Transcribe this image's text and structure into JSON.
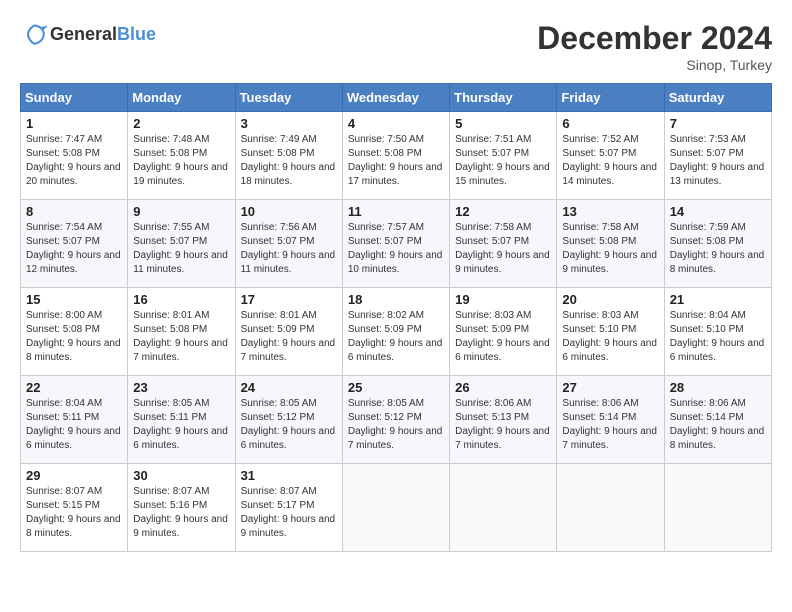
{
  "header": {
    "logo_general": "General",
    "logo_blue": "Blue",
    "month": "December 2024",
    "location": "Sinop, Turkey"
  },
  "weekdays": [
    "Sunday",
    "Monday",
    "Tuesday",
    "Wednesday",
    "Thursday",
    "Friday",
    "Saturday"
  ],
  "weeks": [
    [
      {
        "day": "1",
        "sunrise": "7:47 AM",
        "sunset": "5:08 PM",
        "daylight": "9 hours and 20 minutes."
      },
      {
        "day": "2",
        "sunrise": "7:48 AM",
        "sunset": "5:08 PM",
        "daylight": "9 hours and 19 minutes."
      },
      {
        "day": "3",
        "sunrise": "7:49 AM",
        "sunset": "5:08 PM",
        "daylight": "9 hours and 18 minutes."
      },
      {
        "day": "4",
        "sunrise": "7:50 AM",
        "sunset": "5:08 PM",
        "daylight": "9 hours and 17 minutes."
      },
      {
        "day": "5",
        "sunrise": "7:51 AM",
        "sunset": "5:07 PM",
        "daylight": "9 hours and 15 minutes."
      },
      {
        "day": "6",
        "sunrise": "7:52 AM",
        "sunset": "5:07 PM",
        "daylight": "9 hours and 14 minutes."
      },
      {
        "day": "7",
        "sunrise": "7:53 AM",
        "sunset": "5:07 PM",
        "daylight": "9 hours and 13 minutes."
      }
    ],
    [
      {
        "day": "8",
        "sunrise": "7:54 AM",
        "sunset": "5:07 PM",
        "daylight": "9 hours and 12 minutes."
      },
      {
        "day": "9",
        "sunrise": "7:55 AM",
        "sunset": "5:07 PM",
        "daylight": "9 hours and 11 minutes."
      },
      {
        "day": "10",
        "sunrise": "7:56 AM",
        "sunset": "5:07 PM",
        "daylight": "9 hours and 11 minutes."
      },
      {
        "day": "11",
        "sunrise": "7:57 AM",
        "sunset": "5:07 PM",
        "daylight": "9 hours and 10 minutes."
      },
      {
        "day": "12",
        "sunrise": "7:58 AM",
        "sunset": "5:07 PM",
        "daylight": "9 hours and 9 minutes."
      },
      {
        "day": "13",
        "sunrise": "7:58 AM",
        "sunset": "5:08 PM",
        "daylight": "9 hours and 9 minutes."
      },
      {
        "day": "14",
        "sunrise": "7:59 AM",
        "sunset": "5:08 PM",
        "daylight": "9 hours and 8 minutes."
      }
    ],
    [
      {
        "day": "15",
        "sunrise": "8:00 AM",
        "sunset": "5:08 PM",
        "daylight": "9 hours and 8 minutes."
      },
      {
        "day": "16",
        "sunrise": "8:01 AM",
        "sunset": "5:08 PM",
        "daylight": "9 hours and 7 minutes."
      },
      {
        "day": "17",
        "sunrise": "8:01 AM",
        "sunset": "5:09 PM",
        "daylight": "9 hours and 7 minutes."
      },
      {
        "day": "18",
        "sunrise": "8:02 AM",
        "sunset": "5:09 PM",
        "daylight": "9 hours and 6 minutes."
      },
      {
        "day": "19",
        "sunrise": "8:03 AM",
        "sunset": "5:09 PM",
        "daylight": "9 hours and 6 minutes."
      },
      {
        "day": "20",
        "sunrise": "8:03 AM",
        "sunset": "5:10 PM",
        "daylight": "9 hours and 6 minutes."
      },
      {
        "day": "21",
        "sunrise": "8:04 AM",
        "sunset": "5:10 PM",
        "daylight": "9 hours and 6 minutes."
      }
    ],
    [
      {
        "day": "22",
        "sunrise": "8:04 AM",
        "sunset": "5:11 PM",
        "daylight": "9 hours and 6 minutes."
      },
      {
        "day": "23",
        "sunrise": "8:05 AM",
        "sunset": "5:11 PM",
        "daylight": "9 hours and 6 minutes."
      },
      {
        "day": "24",
        "sunrise": "8:05 AM",
        "sunset": "5:12 PM",
        "daylight": "9 hours and 6 minutes."
      },
      {
        "day": "25",
        "sunrise": "8:05 AM",
        "sunset": "5:12 PM",
        "daylight": "9 hours and 7 minutes."
      },
      {
        "day": "26",
        "sunrise": "8:06 AM",
        "sunset": "5:13 PM",
        "daylight": "9 hours and 7 minutes."
      },
      {
        "day": "27",
        "sunrise": "8:06 AM",
        "sunset": "5:14 PM",
        "daylight": "9 hours and 7 minutes."
      },
      {
        "day": "28",
        "sunrise": "8:06 AM",
        "sunset": "5:14 PM",
        "daylight": "9 hours and 8 minutes."
      }
    ],
    [
      {
        "day": "29",
        "sunrise": "8:07 AM",
        "sunset": "5:15 PM",
        "daylight": "9 hours and 8 minutes."
      },
      {
        "day": "30",
        "sunrise": "8:07 AM",
        "sunset": "5:16 PM",
        "daylight": "9 hours and 9 minutes."
      },
      {
        "day": "31",
        "sunrise": "8:07 AM",
        "sunset": "5:17 PM",
        "daylight": "9 hours and 9 minutes."
      },
      null,
      null,
      null,
      null
    ]
  ]
}
